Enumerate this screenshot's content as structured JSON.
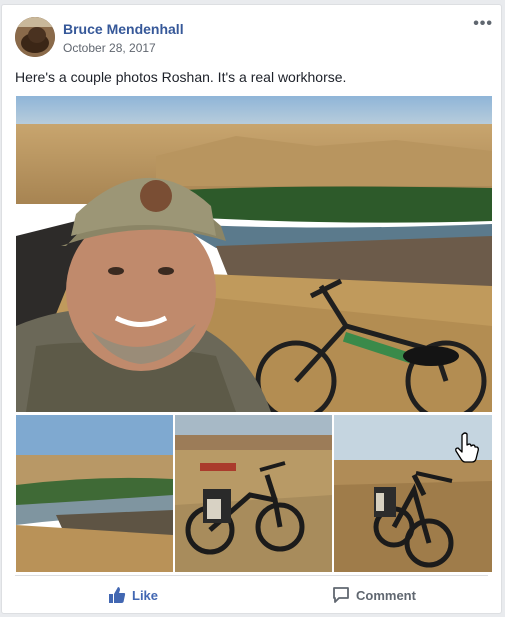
{
  "post": {
    "author": "Bruce Mendenhall",
    "date": "October 28, 2017",
    "more_icon": "more-horizontal-icon",
    "text": "Here's a couple photos Roshan. It's a real workhorse."
  },
  "actions": {
    "like_label": "Like",
    "comment_label": "Comment",
    "like_icon": "thumbs-up-icon",
    "comment_icon": "speech-bubble-icon"
  },
  "colors": {
    "author_link": "#365899",
    "like_active": "#4267b2",
    "feed_background": "#e9ebee"
  }
}
